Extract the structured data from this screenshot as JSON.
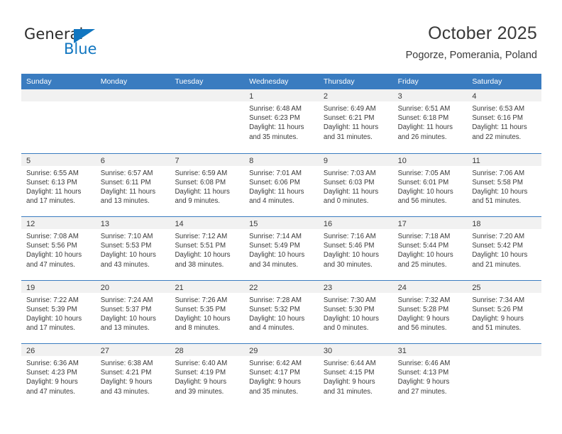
{
  "brand": {
    "name_top": "General",
    "name_bottom": "Blue",
    "triangle_color": "#1176c0",
    "text_color": "#2b2b2b"
  },
  "header": {
    "title": "October 2025",
    "subtitle": "Pogorze, Pomerania, Poland"
  },
  "theme": {
    "header_blue": "#3a7cc0",
    "day_head_gray": "#f1f1f1",
    "text": "#3a3a3a"
  },
  "weekdays": [
    "Sunday",
    "Monday",
    "Tuesday",
    "Wednesday",
    "Thursday",
    "Friday",
    "Saturday"
  ],
  "weeks": [
    [
      {
        "day": "",
        "lines": []
      },
      {
        "day": "",
        "lines": []
      },
      {
        "day": "",
        "lines": []
      },
      {
        "day": "1",
        "lines": [
          "Sunrise: 6:48 AM",
          "Sunset: 6:23 PM",
          "Daylight: 11 hours",
          "and 35 minutes."
        ]
      },
      {
        "day": "2",
        "lines": [
          "Sunrise: 6:49 AM",
          "Sunset: 6:21 PM",
          "Daylight: 11 hours",
          "and 31 minutes."
        ]
      },
      {
        "day": "3",
        "lines": [
          "Sunrise: 6:51 AM",
          "Sunset: 6:18 PM",
          "Daylight: 11 hours",
          "and 26 minutes."
        ]
      },
      {
        "day": "4",
        "lines": [
          "Sunrise: 6:53 AM",
          "Sunset: 6:16 PM",
          "Daylight: 11 hours",
          "and 22 minutes."
        ]
      }
    ],
    [
      {
        "day": "5",
        "lines": [
          "Sunrise: 6:55 AM",
          "Sunset: 6:13 PM",
          "Daylight: 11 hours",
          "and 17 minutes."
        ]
      },
      {
        "day": "6",
        "lines": [
          "Sunrise: 6:57 AM",
          "Sunset: 6:11 PM",
          "Daylight: 11 hours",
          "and 13 minutes."
        ]
      },
      {
        "day": "7",
        "lines": [
          "Sunrise: 6:59 AM",
          "Sunset: 6:08 PM",
          "Daylight: 11 hours",
          "and 9 minutes."
        ]
      },
      {
        "day": "8",
        "lines": [
          "Sunrise: 7:01 AM",
          "Sunset: 6:06 PM",
          "Daylight: 11 hours",
          "and 4 minutes."
        ]
      },
      {
        "day": "9",
        "lines": [
          "Sunrise: 7:03 AM",
          "Sunset: 6:03 PM",
          "Daylight: 11 hours",
          "and 0 minutes."
        ]
      },
      {
        "day": "10",
        "lines": [
          "Sunrise: 7:05 AM",
          "Sunset: 6:01 PM",
          "Daylight: 10 hours",
          "and 56 minutes."
        ]
      },
      {
        "day": "11",
        "lines": [
          "Sunrise: 7:06 AM",
          "Sunset: 5:58 PM",
          "Daylight: 10 hours",
          "and 51 minutes."
        ]
      }
    ],
    [
      {
        "day": "12",
        "lines": [
          "Sunrise: 7:08 AM",
          "Sunset: 5:56 PM",
          "Daylight: 10 hours",
          "and 47 minutes."
        ]
      },
      {
        "day": "13",
        "lines": [
          "Sunrise: 7:10 AM",
          "Sunset: 5:53 PM",
          "Daylight: 10 hours",
          "and 43 minutes."
        ]
      },
      {
        "day": "14",
        "lines": [
          "Sunrise: 7:12 AM",
          "Sunset: 5:51 PM",
          "Daylight: 10 hours",
          "and 38 minutes."
        ]
      },
      {
        "day": "15",
        "lines": [
          "Sunrise: 7:14 AM",
          "Sunset: 5:49 PM",
          "Daylight: 10 hours",
          "and 34 minutes."
        ]
      },
      {
        "day": "16",
        "lines": [
          "Sunrise: 7:16 AM",
          "Sunset: 5:46 PM",
          "Daylight: 10 hours",
          "and 30 minutes."
        ]
      },
      {
        "day": "17",
        "lines": [
          "Sunrise: 7:18 AM",
          "Sunset: 5:44 PM",
          "Daylight: 10 hours",
          "and 25 minutes."
        ]
      },
      {
        "day": "18",
        "lines": [
          "Sunrise: 7:20 AM",
          "Sunset: 5:42 PM",
          "Daylight: 10 hours",
          "and 21 minutes."
        ]
      }
    ],
    [
      {
        "day": "19",
        "lines": [
          "Sunrise: 7:22 AM",
          "Sunset: 5:39 PM",
          "Daylight: 10 hours",
          "and 17 minutes."
        ]
      },
      {
        "day": "20",
        "lines": [
          "Sunrise: 7:24 AM",
          "Sunset: 5:37 PM",
          "Daylight: 10 hours",
          "and 13 minutes."
        ]
      },
      {
        "day": "21",
        "lines": [
          "Sunrise: 7:26 AM",
          "Sunset: 5:35 PM",
          "Daylight: 10 hours",
          "and 8 minutes."
        ]
      },
      {
        "day": "22",
        "lines": [
          "Sunrise: 7:28 AM",
          "Sunset: 5:32 PM",
          "Daylight: 10 hours",
          "and 4 minutes."
        ]
      },
      {
        "day": "23",
        "lines": [
          "Sunrise: 7:30 AM",
          "Sunset: 5:30 PM",
          "Daylight: 10 hours",
          "and 0 minutes."
        ]
      },
      {
        "day": "24",
        "lines": [
          "Sunrise: 7:32 AM",
          "Sunset: 5:28 PM",
          "Daylight: 9 hours",
          "and 56 minutes."
        ]
      },
      {
        "day": "25",
        "lines": [
          "Sunrise: 7:34 AM",
          "Sunset: 5:26 PM",
          "Daylight: 9 hours",
          "and 51 minutes."
        ]
      }
    ],
    [
      {
        "day": "26",
        "lines": [
          "Sunrise: 6:36 AM",
          "Sunset: 4:23 PM",
          "Daylight: 9 hours",
          "and 47 minutes."
        ]
      },
      {
        "day": "27",
        "lines": [
          "Sunrise: 6:38 AM",
          "Sunset: 4:21 PM",
          "Daylight: 9 hours",
          "and 43 minutes."
        ]
      },
      {
        "day": "28",
        "lines": [
          "Sunrise: 6:40 AM",
          "Sunset: 4:19 PM",
          "Daylight: 9 hours",
          "and 39 minutes."
        ]
      },
      {
        "day": "29",
        "lines": [
          "Sunrise: 6:42 AM",
          "Sunset: 4:17 PM",
          "Daylight: 9 hours",
          "and 35 minutes."
        ]
      },
      {
        "day": "30",
        "lines": [
          "Sunrise: 6:44 AM",
          "Sunset: 4:15 PM",
          "Daylight: 9 hours",
          "and 31 minutes."
        ]
      },
      {
        "day": "31",
        "lines": [
          "Sunrise: 6:46 AM",
          "Sunset: 4:13 PM",
          "Daylight: 9 hours",
          "and 27 minutes."
        ]
      },
      {
        "day": "",
        "lines": []
      }
    ]
  ]
}
